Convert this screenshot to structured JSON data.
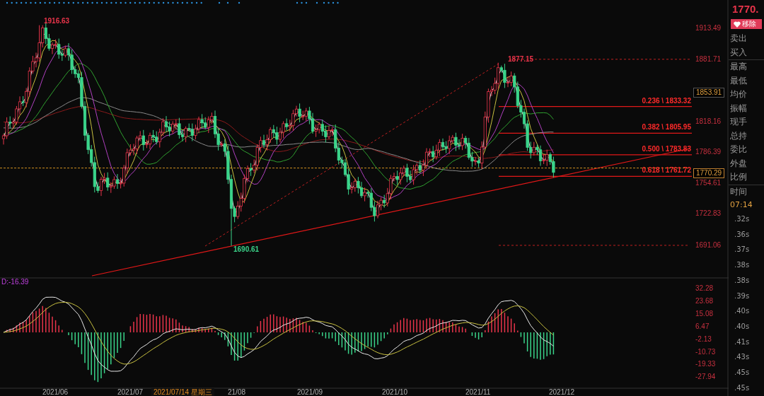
{
  "chart": {
    "high_label": "1916.63",
    "peak_label": "1877.15",
    "low_label": "1690.61",
    "fib_levels": [
      {
        "label": "0.236 \\ 1833.32"
      },
      {
        "label": "0.382 \\ 1805.95"
      },
      {
        "label": "0.500 \\ 1783.83"
      },
      {
        "label": "0.618 \\ 1761.72"
      }
    ]
  },
  "price_axis": [
    {
      "value": "1913.49",
      "kind": "tick"
    },
    {
      "value": "1881.71",
      "kind": "tick"
    },
    {
      "value": "1853.91",
      "kind": "marker"
    },
    {
      "value": "1818.16",
      "kind": "tick"
    },
    {
      "value": "1786.39",
      "kind": "tick"
    },
    {
      "value": "1770.29",
      "kind": "marker"
    },
    {
      "value": "1754.61",
      "kind": "tick"
    },
    {
      "value": "1722.83",
      "kind": "tick"
    },
    {
      "value": "1691.06",
      "kind": "tick"
    }
  ],
  "macd": {
    "label": "D:-16.39",
    "axis": [
      "32.28",
      "23.68",
      "15.08",
      "6.47",
      "-2.13",
      "-10.73",
      "-19.33",
      "-27.94"
    ]
  },
  "time_axis": [
    {
      "label": "2021/06",
      "kind": "tick"
    },
    {
      "label": "2021/07",
      "kind": "tick"
    },
    {
      "label": "2021/07/14 星期三",
      "kind": "cursor"
    },
    {
      "label": "21/08",
      "kind": "tick"
    },
    {
      "label": "2021/09",
      "kind": "tick"
    },
    {
      "label": "2021/10",
      "kind": "tick"
    },
    {
      "label": "2021/11",
      "kind": "tick"
    },
    {
      "label": "2021/12",
      "kind": "tick"
    }
  ],
  "side_panel": {
    "price": "1770.",
    "remove_button": "移除",
    "fields": [
      "卖出",
      "买入",
      "最高",
      "最低",
      "均价",
      "振幅",
      "现手",
      "总持",
      "委比",
      "外盘",
      "比例"
    ],
    "time_label": "时间",
    "time": "07:14",
    "ticks": [
      ".32s",
      ".36s",
      ".37s",
      ".38s",
      ".38s",
      ".39s",
      ".40s",
      ".40s",
      ".41s",
      ".43s",
      ".45s",
      ".45s"
    ]
  }
}
